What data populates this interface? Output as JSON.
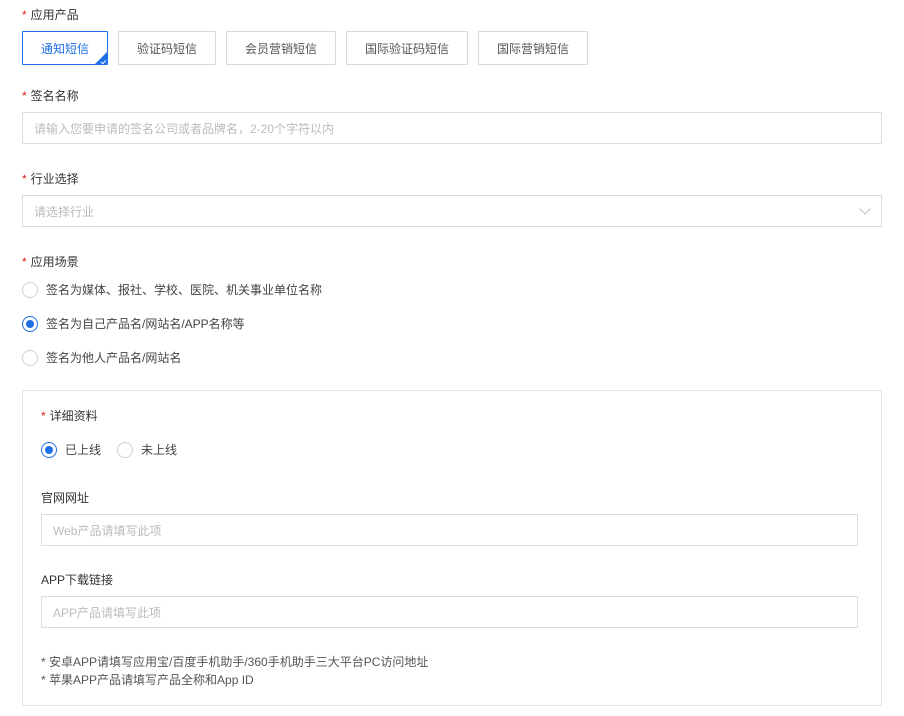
{
  "product": {
    "label": "应用产品",
    "options": [
      "通知短信",
      "验证码短信",
      "会员营销短信",
      "国际验证码短信",
      "国际营销短信"
    ]
  },
  "signature": {
    "label": "签名名称",
    "placeholder": "请输入您要申请的签名公司或者品牌名，2-20个字符以内"
  },
  "industry": {
    "label": "行业选择",
    "placeholder": "请选择行业"
  },
  "scenario": {
    "label": "应用场景",
    "options": [
      "签名为媒体、报社、学校、医院、机关事业单位名称",
      "签名为自己产品名/网站名/APP名称等",
      "签名为他人产品名/网站名"
    ]
  },
  "details": {
    "label": "详细资料",
    "status_options": [
      "已上线",
      "未上线"
    ],
    "website": {
      "label": "官网网址",
      "placeholder": "Web产品请填写此项"
    },
    "app_link": {
      "label": "APP下载链接",
      "placeholder": "APP产品请填写此项"
    },
    "notes": [
      "* 安卓APP请填写应用宝/百度手机助手/360手机助手三大平台PC访问地址",
      "* 苹果APP产品请填写产品全称和App ID"
    ]
  },
  "required_mark": "*",
  "colors": {
    "accent": "#1f6fe5",
    "required": "#e02020",
    "border": "#d9d9d9"
  }
}
